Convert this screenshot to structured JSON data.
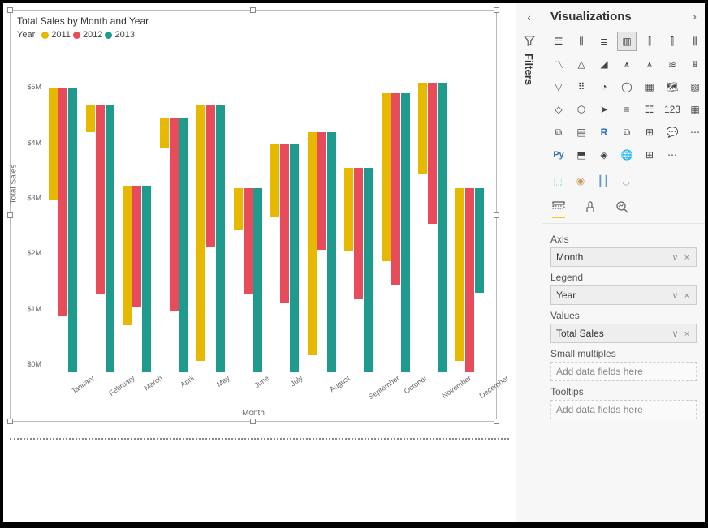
{
  "header_icons": {
    "filter": "filter-icon",
    "focus": "focus-mode-icon",
    "more": "more-options-icon"
  },
  "filters_rail": {
    "label": "Filters"
  },
  "viz_pane": {
    "title": "Visualizations"
  },
  "wells": {
    "axis_label": "Axis",
    "axis_value": "Month",
    "legend_label": "Legend",
    "legend_value": "Year",
    "values_label": "Values",
    "values_value": "Total Sales",
    "small_label": "Small multiples",
    "small_placeholder": "Add data fields here",
    "tooltips_label": "Tooltips",
    "tooltips_placeholder": "Add data fields here"
  },
  "chart_data": {
    "type": "bar",
    "title": "Total Sales by Month and Year",
    "legend_title": "Year",
    "xlabel": "Month",
    "ylabel": "Total Sales",
    "ylim": [
      0,
      5500000
    ],
    "yticks": [
      "$0M",
      "$1M",
      "$2M",
      "$3M",
      "$4M",
      "$5M"
    ],
    "categories": [
      "January",
      "February",
      "March",
      "April",
      "May",
      "June",
      "July",
      "August",
      "September",
      "October",
      "November",
      "December"
    ],
    "series": [
      {
        "name": "2011",
        "color": "#e6b800",
        "values": [
          2000000,
          500000,
          2500000,
          530000,
          4600000,
          750000,
          1300000,
          4000000,
          1500000,
          3000000,
          1650000,
          3100000
        ]
      },
      {
        "name": "2012",
        "color": "#e84b5a",
        "values": [
          4100000,
          3400000,
          2180000,
          3450000,
          2550000,
          1900000,
          2850000,
          2100000,
          2360000,
          3430000,
          2530000,
          3300000
        ]
      },
      {
        "name": "2013",
        "color": "#1f9b8e",
        "values": [
          5100000,
          4800000,
          3350000,
          4550000,
          4800000,
          3300000,
          4100000,
          4300000,
          3670000,
          5000000,
          5200000,
          1880000
        ]
      }
    ]
  }
}
